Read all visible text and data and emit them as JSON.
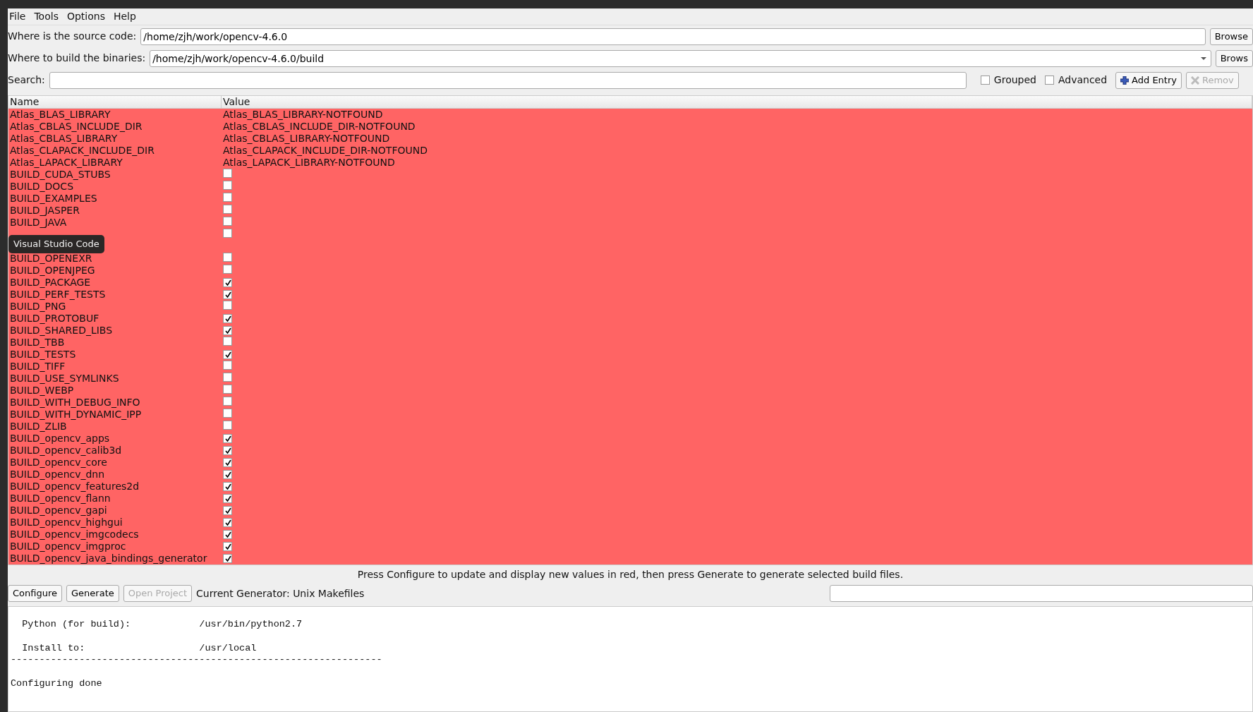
{
  "menu": [
    {
      "label": "File"
    },
    {
      "label": "Tools"
    },
    {
      "label": "Options"
    },
    {
      "label": "Help"
    }
  ],
  "source": {
    "label": "Where is the source code:",
    "value": "/home/zjh/work/opencv-4.6.0",
    "button": "Browse"
  },
  "binaries": {
    "label": "Where to build the binaries:",
    "value": "/home/zjh/work/opencv-4.6.0/build",
    "button": "Brows"
  },
  "search": {
    "label": "Search:",
    "options": [
      {
        "label": "Grouped",
        "checked": false
      },
      {
        "label": "Advanced",
        "checked": false
      }
    ],
    "add_button": {
      "label": "Add Entry",
      "disabled": false
    },
    "remove_button": {
      "label": "Remov",
      "disabled": true
    }
  },
  "table": {
    "columns": [
      "Name",
      "Value"
    ],
    "rows": [
      {
        "kind": "path",
        "name": "Atlas_BLAS_LIBRARY",
        "value": "Atlas_BLAS_LIBRARY-NOTFOUND"
      },
      {
        "kind": "path",
        "name": "Atlas_CBLAS_INCLUDE_DIR",
        "value": "Atlas_CBLAS_INCLUDE_DIR-NOTFOUND"
      },
      {
        "kind": "path",
        "name": "Atlas_CBLAS_LIBRARY",
        "value": "Atlas_CBLAS_LIBRARY-NOTFOUND"
      },
      {
        "kind": "path",
        "name": "Atlas_CLAPACK_INCLUDE_DIR",
        "value": "Atlas_CLAPACK_INCLUDE_DIR-NOTFOUND"
      },
      {
        "kind": "path",
        "name": "Atlas_LAPACK_LIBRARY",
        "value": "Atlas_LAPACK_LIBRARY-NOTFOUND"
      },
      {
        "kind": "bool",
        "name": "BUILD_CUDA_STUBS",
        "checked": false
      },
      {
        "kind": "bool",
        "name": "BUILD_DOCS",
        "checked": false
      },
      {
        "kind": "bool",
        "name": "BUILD_EXAMPLES",
        "checked": false
      },
      {
        "kind": "bool",
        "name": "BUILD_JASPER",
        "checked": false
      },
      {
        "kind": "bool",
        "name": "BUILD_JAVA",
        "checked": false
      },
      {
        "kind": "bool",
        "checked": false
      },
      {
        "kind": "hidden"
      },
      {
        "kind": "bool",
        "name": "BUILD_OPENEXR",
        "checked": false
      },
      {
        "kind": "bool",
        "name": "BUILD_OPENJPEG",
        "checked": false
      },
      {
        "kind": "bool",
        "name": "BUILD_PACKAGE",
        "checked": true
      },
      {
        "kind": "bool",
        "name": "BUILD_PERF_TESTS",
        "checked": true
      },
      {
        "kind": "bool",
        "name": "BUILD_PNG",
        "checked": false
      },
      {
        "kind": "bool",
        "name": "BUILD_PROTOBUF",
        "checked": true
      },
      {
        "kind": "bool",
        "name": "BUILD_SHARED_LIBS",
        "checked": true
      },
      {
        "kind": "bool",
        "name": "BUILD_TBB",
        "checked": false
      },
      {
        "kind": "bool",
        "name": "BUILD_TESTS",
        "checked": true
      },
      {
        "kind": "bool",
        "name": "BUILD_TIFF",
        "checked": false
      },
      {
        "kind": "bool",
        "name": "BUILD_USE_SYMLINKS",
        "checked": false
      },
      {
        "kind": "bool",
        "name": "BUILD_WEBP",
        "checked": false
      },
      {
        "kind": "bool",
        "name": "BUILD_WITH_DEBUG_INFO",
        "checked": false
      },
      {
        "kind": "bool",
        "name": "BUILD_WITH_DYNAMIC_IPP",
        "checked": false
      },
      {
        "kind": "bool",
        "name": "BUILD_ZLIB",
        "checked": false
      },
      {
        "kind": "bool",
        "name": "BUILD_opencv_apps",
        "checked": true
      },
      {
        "kind": "bool",
        "name": "BUILD_opencv_calib3d",
        "checked": true
      },
      {
        "kind": "bool",
        "name": "BUILD_opencv_core",
        "checked": true
      },
      {
        "kind": "bool",
        "name": "BUILD_opencv_dnn",
        "checked": true
      },
      {
        "kind": "bool",
        "name": "BUILD_opencv_features2d",
        "checked": true
      },
      {
        "kind": "bool",
        "name": "BUILD_opencv_flann",
        "checked": true
      },
      {
        "kind": "bool",
        "name": "BUILD_opencv_gapi",
        "checked": true
      },
      {
        "kind": "bool",
        "name": "BUILD_opencv_highgui",
        "checked": true
      },
      {
        "kind": "bool",
        "name": "BUILD_opencv_imgcodecs",
        "checked": true
      },
      {
        "kind": "bool",
        "name": "BUILD_opencv_imgproc",
        "checked": true
      },
      {
        "kind": "bool",
        "name": "BUILD_opencv_java_bindings_generator",
        "checked": true
      }
    ]
  },
  "tooltip": "Visual Studio Code",
  "message": "Press Configure to update and display new values in red, then press Generate to generate selected build files.",
  "buttons": [
    {
      "label": "Configure",
      "disabled": false
    },
    {
      "label": "Generate",
      "disabled": false
    },
    {
      "label": "Open Project",
      "disabled": true
    }
  ],
  "generator": "Current Generator: Unix Makefiles",
  "log": "  Python (for build):            /usr/bin/python2.7\n\n  Install to:                    /usr/local\n-----------------------------------------------------------------\n\nConfiguring done"
}
